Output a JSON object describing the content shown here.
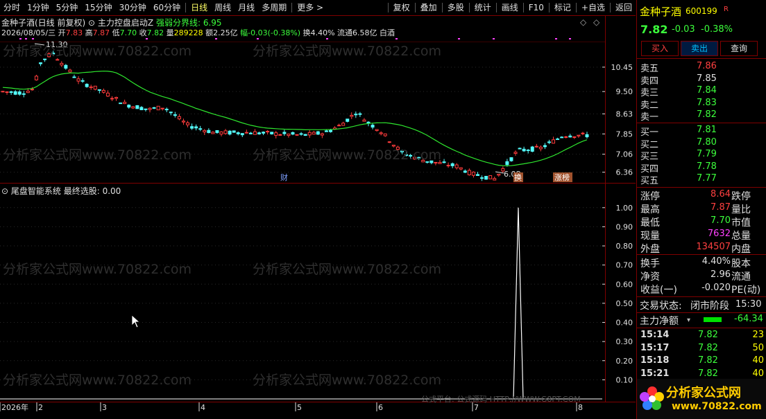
{
  "toolbar": {
    "left": [
      "分时",
      "1分钟",
      "5分钟",
      "15分钟",
      "30分钟",
      "60分钟",
      "日线",
      "周线",
      "月线",
      "多周期",
      "更多 >"
    ],
    "active": "日线",
    "right": [
      "复权",
      "叠加",
      "多股",
      "统计",
      "画线",
      "F10",
      "标记",
      "+自选",
      "返回"
    ]
  },
  "stock": {
    "title": "金种子酒(日线 前复权)",
    "indicator": "主力控盘启动Z",
    "strength_label": "强弱分界线:",
    "strength_value": "6.95",
    "info_date": "2026/08/05/三",
    "info_open_lbl": "开",
    "info_open": "7.83",
    "info_high_lbl": "高",
    "info_high": "7.87",
    "info_low_lbl": "低",
    "info_low": "7.70",
    "info_close_lbl": "收",
    "info_close": "7.82",
    "info_vol_lbl": "量",
    "info_vol": "289228",
    "info_amt": "额2.25亿",
    "info_chg": "幅-0.03(-0.38%)",
    "info_turn": "换4.40%",
    "info_float": "流通6.58亿",
    "info_sector": "白酒"
  },
  "price_axis": [
    "10.45",
    "9.50",
    "8.63",
    "7.85",
    "7.06",
    "6.36"
  ],
  "annotations": {
    "high": "11.30",
    "low": "6.08",
    "cai": "财",
    "huan": "换",
    "zhangting": "涨榜"
  },
  "lower_panel": {
    "title": "尾盘智能系统",
    "sub": "最终选股: 0.00",
    "axis": [
      "1.00",
      "0.90",
      "0.80",
      "0.70",
      "0.60",
      "0.50",
      "0.40",
      "0.30",
      "0.20",
      "0.10"
    ]
  },
  "date_axis": [
    "2026年",
    "2",
    "3",
    "4",
    "5",
    "6",
    "7",
    "8"
  ],
  "footer_hint": "公式平台: 公式源码 HTTP://WWW.G8PT.COM",
  "watermark": "分析家公式网www.70822.com",
  "chart_data": {
    "type": "candlestick",
    "ylim": [
      6.0,
      11.5
    ],
    "last_close": 7.82,
    "indicator_line": "强弱分界线",
    "signal_series": {
      "name": "最终选股",
      "peak_value": 1.0,
      "ylim": [
        0,
        1.05
      ]
    }
  },
  "right_panel": {
    "name": "金种子酒",
    "code": "600199",
    "flag": "R",
    "price": "7.82",
    "change": "-0.03",
    "pct": "-0.38%",
    "buy_btn": "买入",
    "sell_btn": "卖出",
    "query_btn": "查询",
    "sells": [
      {
        "label": "卖五",
        "price": "7.86"
      },
      {
        "label": "卖四",
        "price": "7.85"
      },
      {
        "label": "卖三",
        "price": "7.84"
      },
      {
        "label": "卖二",
        "price": "7.83"
      },
      {
        "label": "卖一",
        "price": "7.82"
      }
    ],
    "buys": [
      {
        "label": "买一",
        "price": "7.81"
      },
      {
        "label": "买二",
        "price": "7.80"
      },
      {
        "label": "买三",
        "price": "7.79"
      },
      {
        "label": "买四",
        "price": "7.78"
      },
      {
        "label": "买五",
        "price": "7.77"
      }
    ],
    "stats": [
      {
        "l1": "涨停",
        "v1": "8.64",
        "l2": "跌停"
      },
      {
        "l1": "最高",
        "v1": "7.87",
        "l2": "量比"
      },
      {
        "l1": "最低",
        "v1": "7.70",
        "l2": "市值"
      },
      {
        "l1": "现量",
        "v1": "7632",
        "l2": "总量"
      },
      {
        "l1": "外盘",
        "v1": "134507",
        "l2": "内盘"
      }
    ],
    "stats2": [
      {
        "l1": "换手",
        "v1": "4.40%",
        "l2": "股本"
      },
      {
        "l1": "净资",
        "v1": "2.96",
        "l2": "流通"
      },
      {
        "l1": "收益(一)",
        "v1": "-0.020",
        "l2": "PE(动)"
      }
    ],
    "trade_status_lbl": "交易状态:",
    "trade_status": "闭市阶段",
    "trade_time": "15:30",
    "net_flow_lbl": "主力净额",
    "net_flow": "-64.34",
    "ticks": [
      {
        "time": "15:14",
        "price": "7.82",
        "vol": "23"
      },
      {
        "time": "15:17",
        "price": "7.82",
        "vol": "50"
      },
      {
        "time": "15:18",
        "price": "7.82",
        "vol": "40"
      },
      {
        "time": "15:21",
        "price": "7.82",
        "vol": "40"
      }
    ],
    "logo_text": "分析家公式网",
    "logo_url": "www.70822.com"
  },
  "colors": {
    "up": "#ff3c3c",
    "down": "#54fcfc",
    "ma": "#2ee62e",
    "frame": "#800000"
  }
}
